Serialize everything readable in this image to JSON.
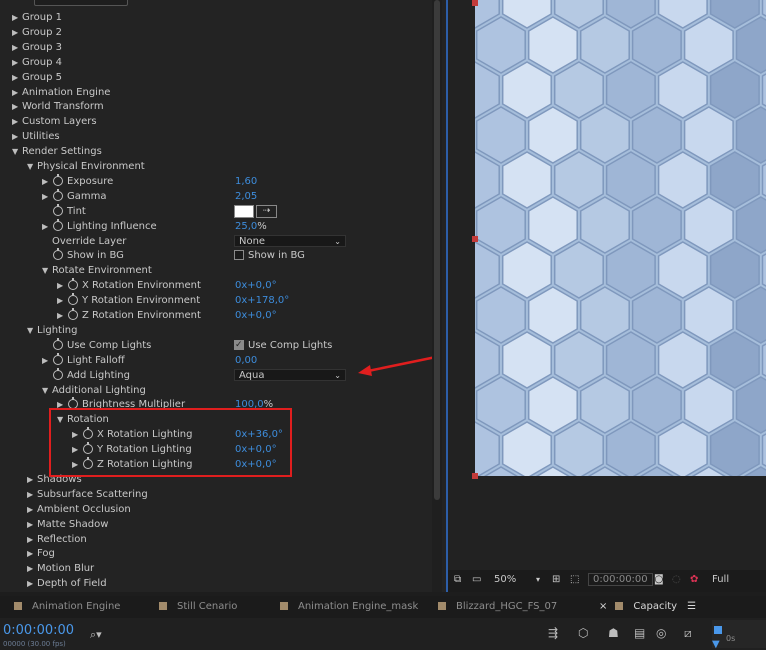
{
  "properties": {
    "rows": [
      {
        "indent": 0,
        "toggle": "closed",
        "label": "Group 1"
      },
      {
        "indent": 0,
        "toggle": "closed",
        "label": "Group 2"
      },
      {
        "indent": 0,
        "toggle": "closed",
        "label": "Group 3"
      },
      {
        "indent": 0,
        "toggle": "closed",
        "label": "Group 4"
      },
      {
        "indent": 0,
        "toggle": "closed",
        "label": "Group 5"
      },
      {
        "indent": 0,
        "toggle": "closed",
        "label": "Animation Engine"
      },
      {
        "indent": 0,
        "toggle": "closed",
        "label": "World Transform"
      },
      {
        "indent": 0,
        "toggle": "closed",
        "label": "Custom Layers"
      },
      {
        "indent": 0,
        "toggle": "closed",
        "label": "Utilities"
      },
      {
        "indent": 0,
        "toggle": "open",
        "label": "Render Settings"
      },
      {
        "indent": 1,
        "toggle": "open",
        "label": "Physical Environment"
      },
      {
        "indent": 2,
        "toggle": "closed",
        "stopwatch": true,
        "label": "Exposure",
        "value": "1,60"
      },
      {
        "indent": 2,
        "toggle": "closed",
        "stopwatch": true,
        "label": "Gamma",
        "value": "2,05"
      },
      {
        "indent": 2,
        "toggle": "none",
        "stopwatch": true,
        "label": "Tint",
        "color": true
      },
      {
        "indent": 2,
        "toggle": "closed",
        "stopwatch": true,
        "label": "Lighting Influence",
        "value": "25,0",
        "unit": "%"
      },
      {
        "indent": 2,
        "toggle": "none",
        "label": "Override Layer",
        "dropdown": "None"
      },
      {
        "indent": 2,
        "toggle": "none",
        "stopwatch": true,
        "label": "Show in BG",
        "checkbox": false,
        "checkbox_label": "Show in BG"
      },
      {
        "indent": 2,
        "toggle": "open",
        "label": "Rotate Environment"
      },
      {
        "indent": 3,
        "toggle": "closed",
        "stopwatch": true,
        "label": "X Rotation Environment",
        "value": "0x+0,0°"
      },
      {
        "indent": 3,
        "toggle": "closed",
        "stopwatch": true,
        "label": "Y Rotation Environment",
        "value": "0x+178,0°"
      },
      {
        "indent": 3,
        "toggle": "closed",
        "stopwatch": true,
        "label": "Z Rotation Environment",
        "value": "0x+0,0°"
      },
      {
        "indent": 1,
        "toggle": "open",
        "label": "Lighting"
      },
      {
        "indent": 2,
        "toggle": "none",
        "stopwatch": true,
        "label": "Use Comp Lights",
        "checkbox": true,
        "checkbox_label": "Use Comp Lights"
      },
      {
        "indent": 2,
        "toggle": "closed",
        "stopwatch": true,
        "label": "Light Falloff",
        "value": "0,00"
      },
      {
        "indent": 2,
        "toggle": "none",
        "stopwatch": true,
        "label": "Add Lighting",
        "dropdown": "Aqua"
      },
      {
        "indent": 2,
        "toggle": "open",
        "label": "Additional Lighting"
      },
      {
        "indent": 3,
        "toggle": "closed",
        "stopwatch": true,
        "label": "Brightness Multiplier",
        "value": "100,0",
        "unit": "%"
      },
      {
        "indent": 3,
        "toggle": "open",
        "label": "Rotation"
      },
      {
        "indent": 4,
        "toggle": "closed",
        "stopwatch": true,
        "label": "X Rotation Lighting",
        "value": "0x+36,0°"
      },
      {
        "indent": 4,
        "toggle": "closed",
        "stopwatch": true,
        "label": "Y Rotation Lighting",
        "value": "0x+0,0°"
      },
      {
        "indent": 4,
        "toggle": "closed",
        "stopwatch": true,
        "label": "Z Rotation Lighting",
        "value": "0x+0,0°"
      },
      {
        "indent": 1,
        "toggle": "closed",
        "label": "Shadows"
      },
      {
        "indent": 1,
        "toggle": "closed",
        "label": "Subsurface Scattering"
      },
      {
        "indent": 1,
        "toggle": "closed",
        "label": "Ambient Occlusion"
      },
      {
        "indent": 1,
        "toggle": "closed",
        "label": "Matte Shadow"
      },
      {
        "indent": 1,
        "toggle": "closed",
        "label": "Reflection"
      },
      {
        "indent": 1,
        "toggle": "closed",
        "label": "Fog"
      },
      {
        "indent": 1,
        "toggle": "closed",
        "label": "Motion Blur"
      },
      {
        "indent": 1,
        "toggle": "closed",
        "label": "Depth of Field"
      }
    ]
  },
  "viewer_toolbar": {
    "zoom": "50%",
    "timecode": "0:00:00:00",
    "resolution": "Full"
  },
  "tabs": [
    {
      "label": "Animation Engine"
    },
    {
      "label": "Still Cenario"
    },
    {
      "label": "Animation Engine_mask"
    },
    {
      "label": "Blizzard_HGC_FS_07"
    },
    {
      "label": "Capacity",
      "active": true
    }
  ],
  "timeline": {
    "current_time": "0:00:00:00",
    "fps": "00000 (30.00 fps)",
    "ruler_label": "0s"
  },
  "colors": {
    "accent": "#3d8cdb",
    "highlight_box": "#e01e1e",
    "viewer_bg": "#a6bedb"
  }
}
